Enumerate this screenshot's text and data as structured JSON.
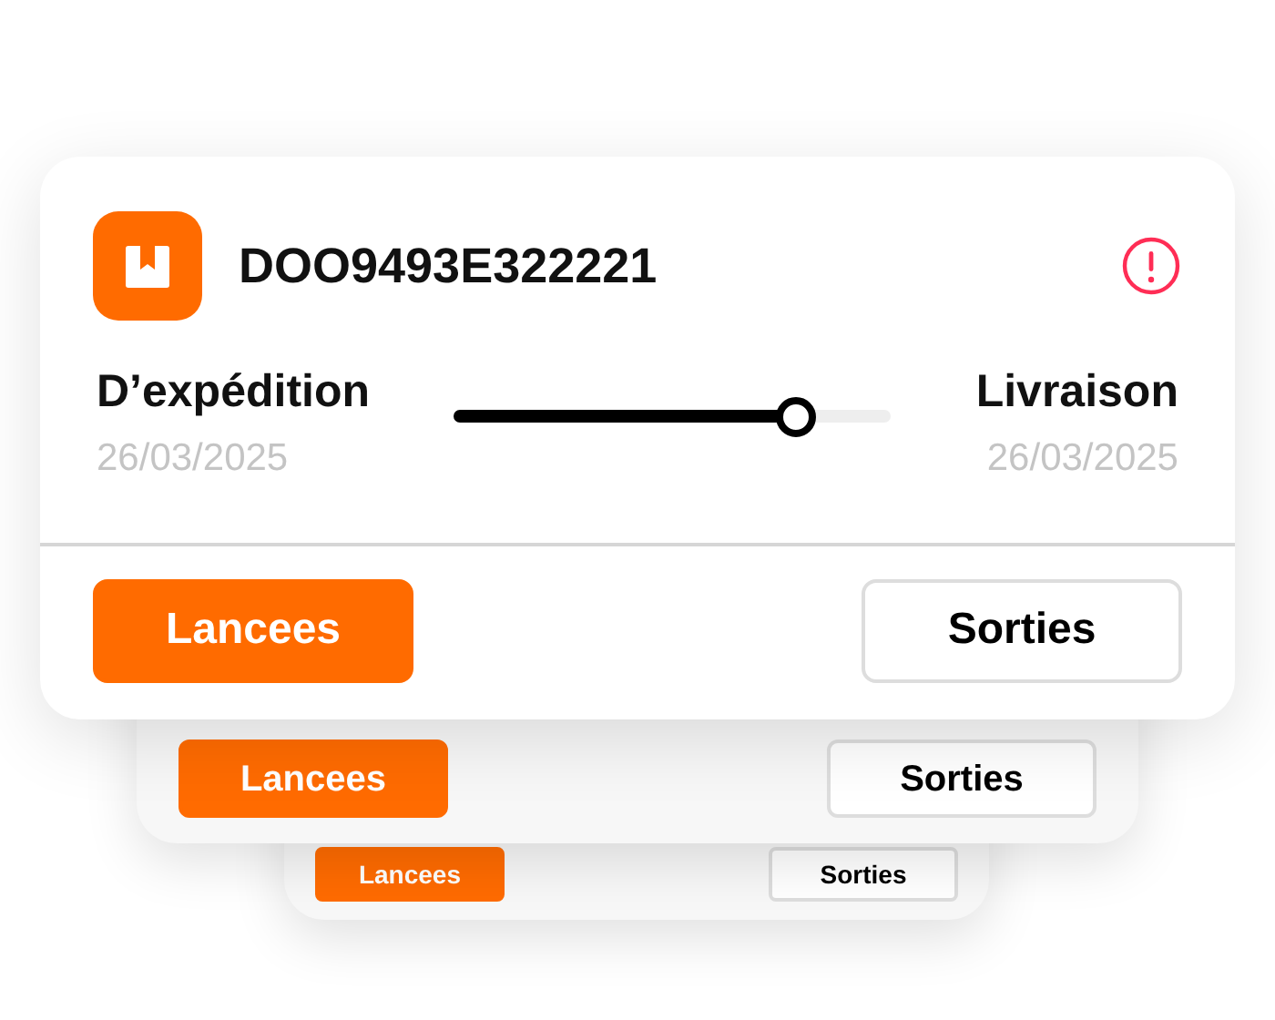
{
  "stacked_cards": [
    {
      "buttons": [
        {
          "label": "Lancees",
          "selected": true
        },
        {
          "label": "Sorties",
          "selected": false
        }
      ]
    },
    {
      "buttons": [
        {
          "label": "Lancees",
          "selected": true
        },
        {
          "label": "Sorties",
          "selected": false
        }
      ]
    }
  ],
  "shipment": {
    "id": "DOO9493E322221",
    "origin": {
      "label": "D’expédition",
      "date": "26/03/2025"
    },
    "destination": {
      "label": "Livraison",
      "date": "26/03/2025"
    },
    "progress": {
      "level": 0.78
    },
    "buttons": [
      {
        "label": "Lancees",
        "selected": true
      },
      {
        "label": "Sorties",
        "selected": false
      }
    ]
  }
}
